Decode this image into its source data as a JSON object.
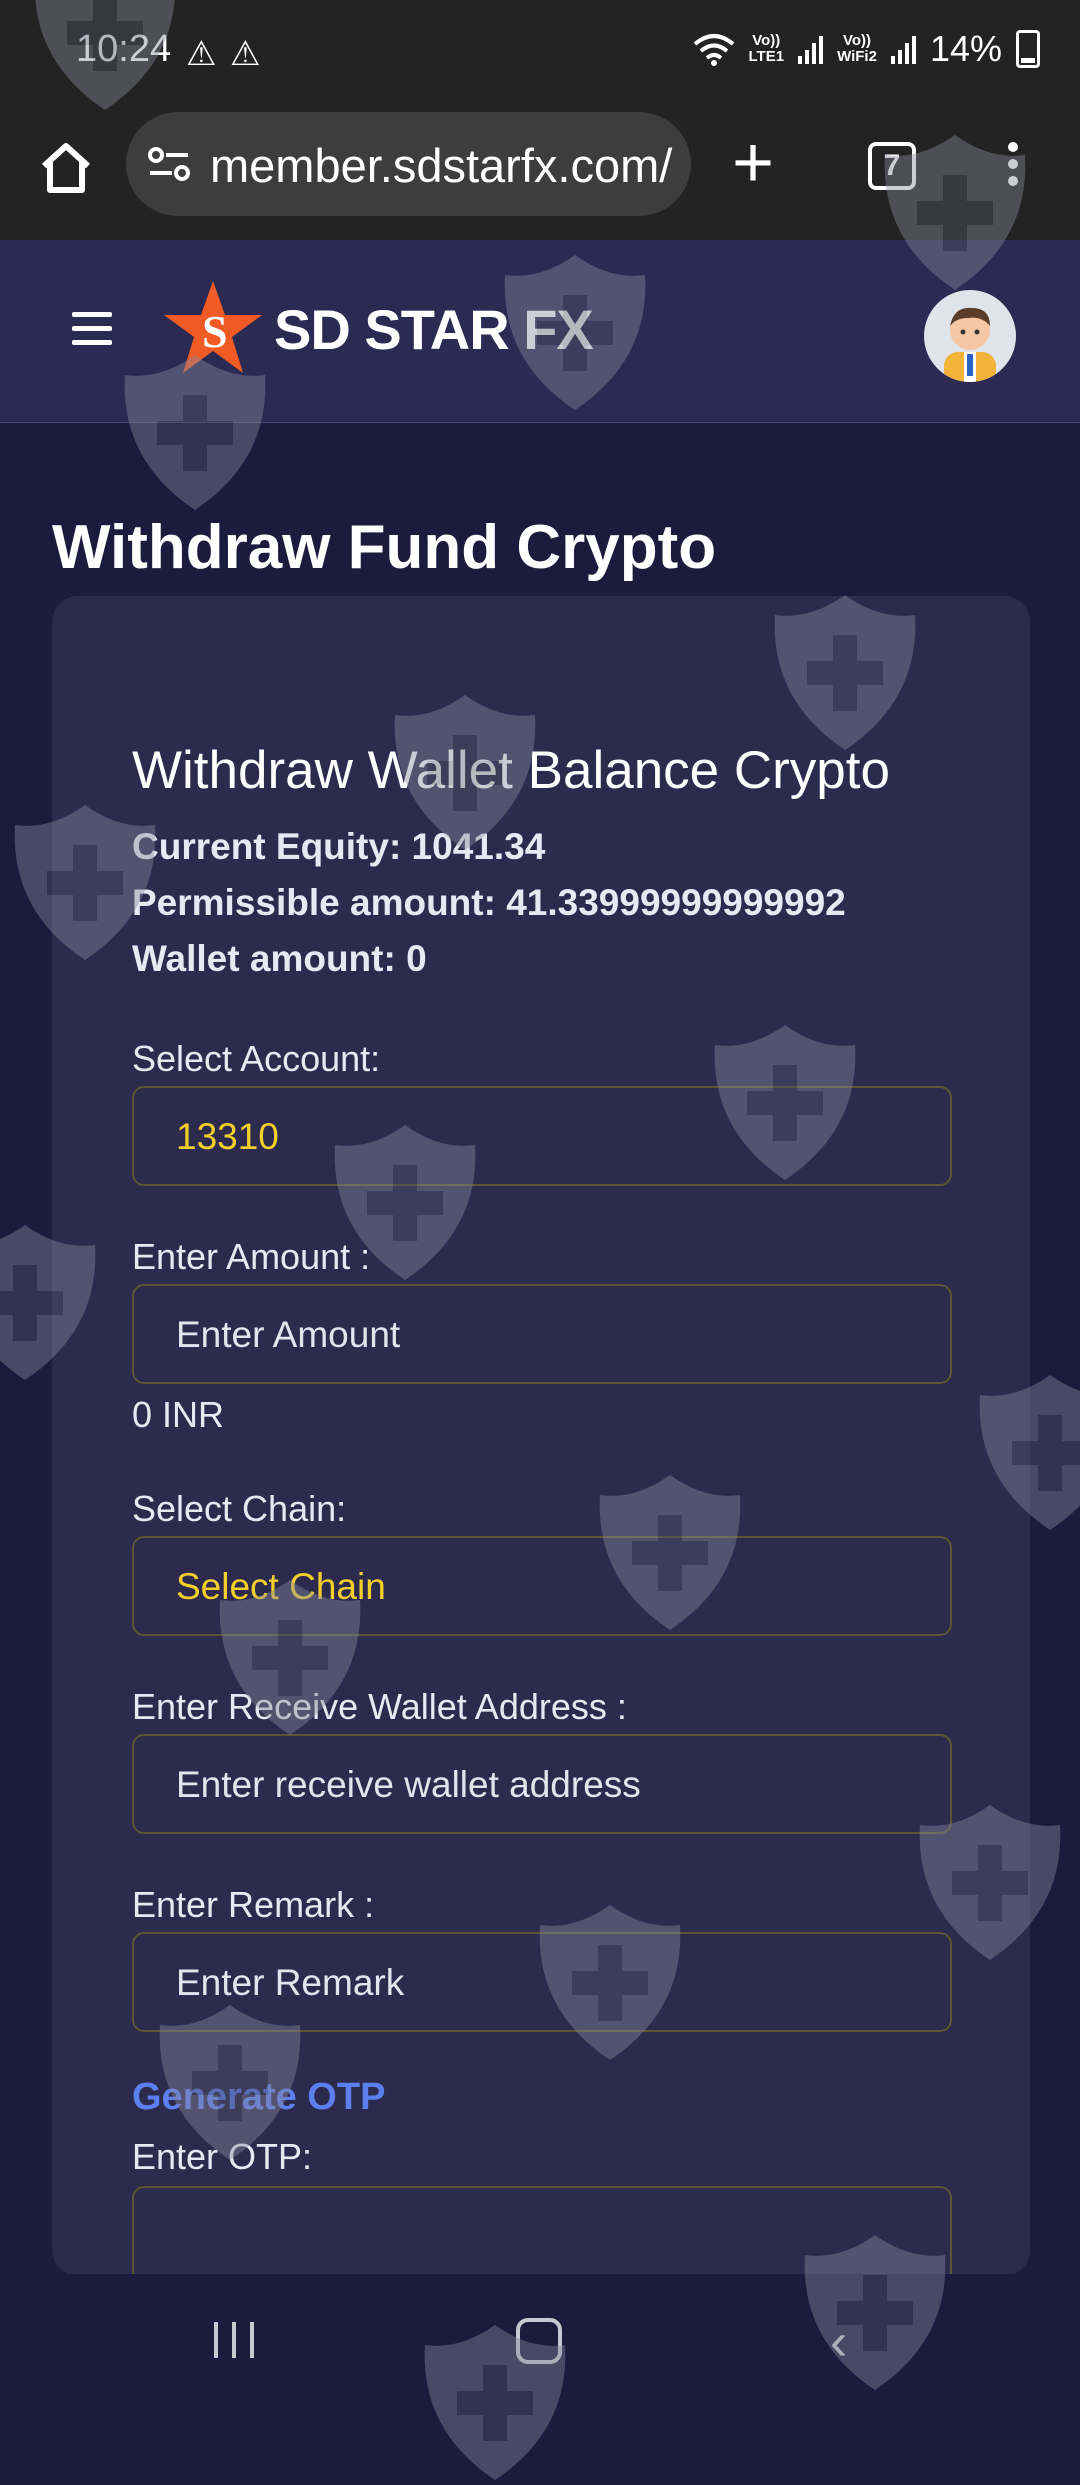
{
  "status_bar": {
    "time": "10:24",
    "warn1": "⚠",
    "warn2": "⚠",
    "sim1_top": "Vo))",
    "sim1_bottom": "LTE1",
    "sim2_top": "Vo))",
    "sim2_bottom": "WiFi2",
    "battery": "14%"
  },
  "browser": {
    "url": "member.sdstarfx.com/",
    "tab_count": "7",
    "new_tab_glyph": "+"
  },
  "site": {
    "logo_text": "SD STAR FX"
  },
  "page": {
    "title": "Withdraw Fund Crypto"
  },
  "card": {
    "title": "Withdraw Wallet Balance Crypto",
    "current_equity": "Current Equity: 1041.34",
    "permissible_amount": "Permissible amount: 41.33999999999992",
    "wallet_amount": "Wallet amount: 0",
    "select_account_label": "Select Account:",
    "select_account_value": "13310",
    "amount_label": "Enter Amount :",
    "amount_placeholder": "Enter Amount",
    "amount_inr": "0 INR",
    "chain_label": "Select Chain:",
    "chain_value": "Select Chain",
    "wallet_address_label": "Enter Receive Wallet Address :",
    "wallet_address_placeholder": "Enter receive wallet address",
    "remark_label": "Enter Remark :",
    "remark_placeholder": "Enter Remark",
    "generate_otp": "Generate OTP",
    "otp_label": "Enter OTP:"
  },
  "colors": {
    "page_bg": "#1c1b3d",
    "card_bg": "#2c2b4e",
    "accent_yellow": "#f4cf2a",
    "link_blue": "#5c7ff0"
  }
}
